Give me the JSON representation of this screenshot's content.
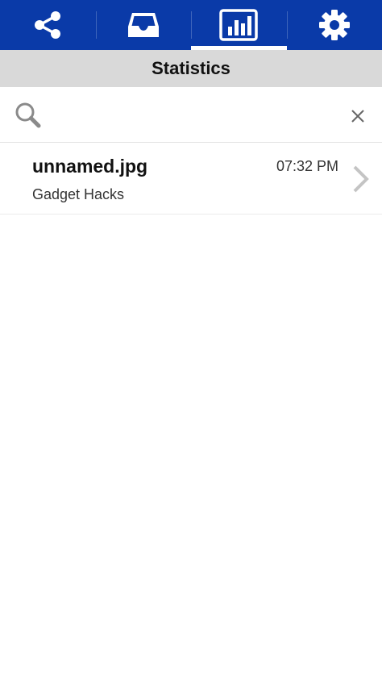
{
  "tabs": [
    {
      "icon": "share-icon",
      "active": false
    },
    {
      "icon": "inbox-icon",
      "active": false
    },
    {
      "icon": "statistics-icon",
      "active": true
    },
    {
      "icon": "gear-icon",
      "active": false
    }
  ],
  "header": {
    "title": "Statistics"
  },
  "search": {
    "value": "",
    "placeholder": ""
  },
  "list": {
    "items": [
      {
        "title": "unnamed.jpg",
        "subtitle": "Gadget Hacks",
        "time": "07:32 PM"
      }
    ]
  },
  "colors": {
    "tabbar": "#0a3aa8",
    "titlebar": "#d9d9d9",
    "text": "#111111"
  }
}
